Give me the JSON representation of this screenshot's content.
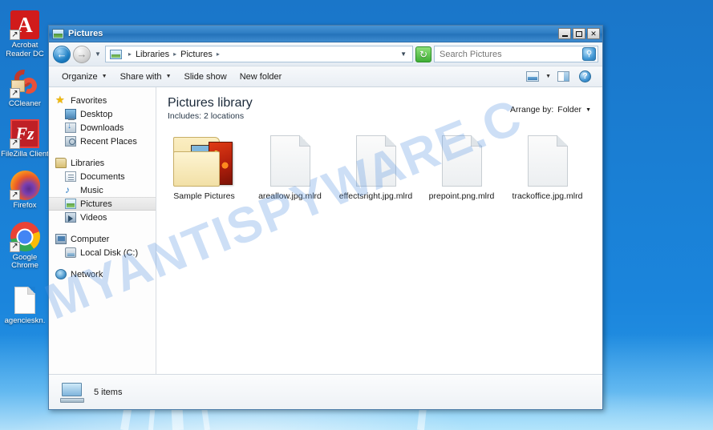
{
  "desktop": {
    "icons": [
      {
        "name": "acrobat-reader",
        "label": "Acrobat Reader DC",
        "glyph": "A"
      },
      {
        "name": "ccleaner",
        "label": "CCleaner",
        "glyph": ""
      },
      {
        "name": "filezilla",
        "label": "FileZilla Client",
        "glyph": "Fz"
      },
      {
        "name": "firefox",
        "label": "Firefox",
        "glyph": ""
      },
      {
        "name": "google-chrome",
        "label": "Google Chrome",
        "glyph": ""
      },
      {
        "name": "encrypted-document",
        "label": "agencieskn.",
        "glyph": ""
      }
    ]
  },
  "watermark": {
    "text": "MYANTISPYWARE.C"
  },
  "window": {
    "title": "Pictures",
    "controls": {
      "minimize": "minimize",
      "maximize": "maximize",
      "close": "✕"
    }
  },
  "addressbar": {
    "back": "←",
    "forward": "→",
    "history_caret": "▼",
    "crumbs": [
      "Libraries",
      "Pictures"
    ],
    "crumb_sep": "▸",
    "crumb_dropdown": "▼",
    "refresh": "↻"
  },
  "search": {
    "value": "",
    "placeholder": "Search Pictures",
    "button_icon": "⚲"
  },
  "commandbar": {
    "items": [
      {
        "label": "Organize",
        "caret": "▼"
      },
      {
        "label": "Share with",
        "caret": "▼"
      },
      {
        "label": "Slide show",
        "caret": ""
      },
      {
        "label": "New folder",
        "caret": ""
      }
    ],
    "view_caret": "▼",
    "help_label": "?"
  },
  "navpane": {
    "groups": [
      {
        "header": {
          "label": "Favorites",
          "icon": "star-icon"
        },
        "items": [
          {
            "label": "Desktop",
            "icon": "desktop-icon"
          },
          {
            "label": "Downloads",
            "icon": "downloads-icon"
          },
          {
            "label": "Recent Places",
            "icon": "recent-places-icon"
          }
        ]
      },
      {
        "header": {
          "label": "Libraries",
          "icon": "libraries-icon"
        },
        "items": [
          {
            "label": "Documents",
            "icon": "documents-icon"
          },
          {
            "label": "Music",
            "icon": "music-icon"
          },
          {
            "label": "Pictures",
            "icon": "pictures-icon",
            "selected": true
          },
          {
            "label": "Videos",
            "icon": "videos-icon"
          }
        ]
      },
      {
        "header": {
          "label": "Computer",
          "icon": "computer-icon"
        },
        "items": [
          {
            "label": "Local Disk (C:)",
            "icon": "disk-icon"
          }
        ]
      },
      {
        "header": {
          "label": "Network",
          "icon": "network-icon"
        },
        "items": []
      }
    ]
  },
  "library": {
    "title": "Pictures library",
    "subtitle": "Includes:  2 locations",
    "arrange_label": "Arrange by:",
    "arrange_value": "Folder",
    "arrange_caret": "▼"
  },
  "files": [
    {
      "name": "Sample Pictures",
      "type": "folder"
    },
    {
      "name": "areallow.jpg.mlrd",
      "type": "file"
    },
    {
      "name": "effectsright.jpg.mlrd",
      "type": "file"
    },
    {
      "name": "prepoint.png.mlrd",
      "type": "file"
    },
    {
      "name": "trackoffice.jpg.mlrd",
      "type": "file"
    }
  ],
  "statusbar": {
    "text": "5 items"
  }
}
